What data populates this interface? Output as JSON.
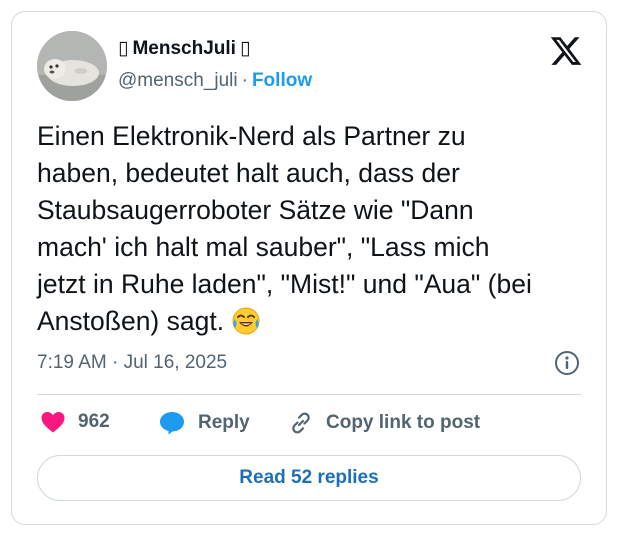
{
  "author": {
    "display_name": "MenschJuli",
    "name_prefix_glyph": "▯",
    "name_suffix_glyph": "▯",
    "handle": "@mensch_juli",
    "separator": "·",
    "follow_label": "Follow",
    "avatar_icon": "seal-photo-avatar"
  },
  "brand": {
    "logo_icon": "x-logo-icon"
  },
  "tweet": {
    "text": "Einen Elektronik-Nerd als Partner zu\nhaben, bedeutet halt auch, dass der\nStaubsaugerroboter Sätze wie \"Dann\nmach' ich halt mal sauber\", \"Lass mich\njetzt in Ruhe laden\", \"Mist!\" und \"Aua\" (bei\nAnstoßen) sagt.",
    "emoji_icon": "face-with-tears-of-joy-emoji",
    "timestamp": "7:19 AM · Jul 16, 2025"
  },
  "actions": {
    "likes_count": "962",
    "reply_label": "Reply",
    "copy_link_label": "Copy link to post"
  },
  "footer": {
    "read_replies_label": "Read 52 replies"
  },
  "colors": {
    "accent": "#1d9bf0",
    "like": "#f91880",
    "reply_icon": "#1d9bf0",
    "text_primary": "#0f1419",
    "text_secondary": "#536471",
    "border": "#cfd9de"
  }
}
